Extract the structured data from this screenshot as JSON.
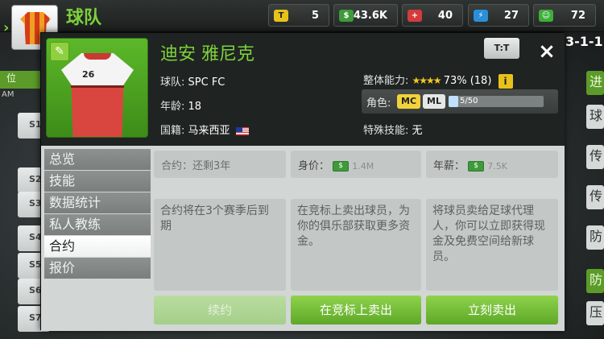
{
  "topbar": {
    "title": "球队",
    "stats": [
      {
        "icon": "token-icon",
        "value": "5",
        "color": "#e8c21a"
      },
      {
        "icon": "cash-icon",
        "value": "43.6K",
        "color": "#3f9a3a"
      },
      {
        "icon": "medical-icon",
        "value": "40",
        "color": "#d43c3c"
      },
      {
        "icon": "energy-icon",
        "value": "27",
        "color": "#2a8fd8"
      },
      {
        "icon": "morale-icon",
        "value": "72",
        "color": "#3fae3a"
      }
    ]
  },
  "background": {
    "left_tab_label": "位",
    "left_sub_label": "AM",
    "left_rows": [
      "S1",
      "S2",
      "S3",
      "S4",
      "S5",
      "S6",
      "S7"
    ],
    "formation": "3-1-1",
    "right_items": [
      "进",
      "球",
      "传",
      "传",
      "防",
      "防",
      "压"
    ]
  },
  "player": {
    "name": "迪安 雅尼克",
    "kit_number": "26",
    "team_label": "球队: ",
    "team": "SPC FC",
    "age_label": "年龄: ",
    "age": "18",
    "nationality_label": "国籍: ",
    "nationality": "马来西亚",
    "overall_label": "整体能力: ",
    "overall_stars": "★★★★",
    "overall_value": "73% (18)",
    "info_badge": "i",
    "role_label": "角色:",
    "roles": [
      "MC",
      "ML"
    ],
    "xp_text": "5/50",
    "xp_fraction": 0.1,
    "special_skill_label": "特殊技能: ",
    "special_skill": "无",
    "kit_button": "T:T",
    "close": "×"
  },
  "menu": {
    "items": [
      "总览",
      "技能",
      "数据统计",
      "私人教练",
      "合约",
      "报价"
    ],
    "active": "合约"
  },
  "contract": {
    "contract_label": "合约：",
    "contract_value": "还剩3年",
    "value_label": "身价：",
    "value_amount": "1.4M",
    "salary_label": "年薪：",
    "salary_amount": "7.5K",
    "descriptions": [
      "合约将在3个赛季后到期",
      "在竞标上卖出球员，为你的俱乐部获取更多资金。",
      "将球员卖给足球代理人，你可以立即获得现金及免费空间给新球员。"
    ],
    "buttons": {
      "renew": "续约",
      "auction": "在竞标上卖出",
      "sell_now": "立刻卖出"
    }
  }
}
